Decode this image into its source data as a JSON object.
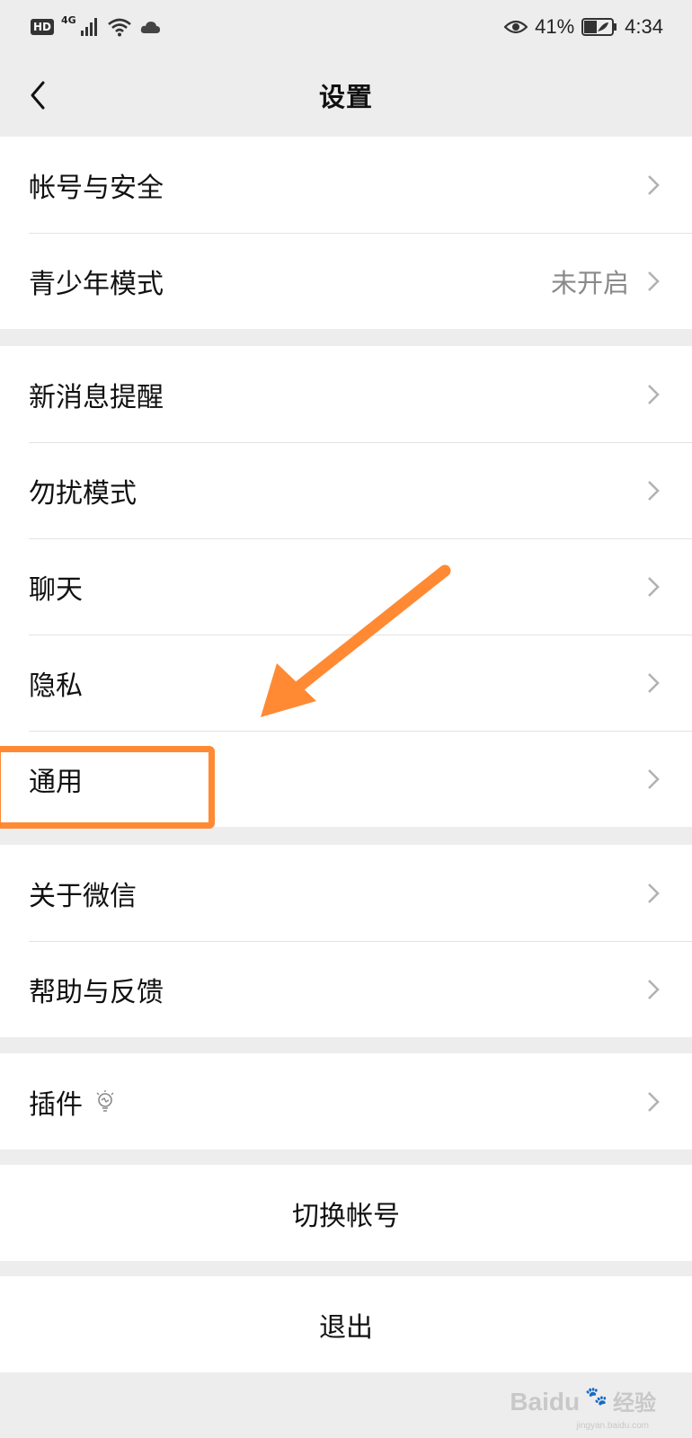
{
  "status_bar": {
    "hd": "HD",
    "network": "4G",
    "battery_percent": "41%",
    "time": "4:34"
  },
  "header": {
    "title": "设置"
  },
  "groups": [
    {
      "items": [
        {
          "label": "帐号与安全",
          "value": ""
        },
        {
          "label": "青少年模式",
          "value": "未开启"
        }
      ]
    },
    {
      "items": [
        {
          "label": "新消息提醒",
          "value": ""
        },
        {
          "label": "勿扰模式",
          "value": ""
        },
        {
          "label": "聊天",
          "value": ""
        },
        {
          "label": "隐私",
          "value": ""
        },
        {
          "label": "通用",
          "value": ""
        }
      ]
    },
    {
      "items": [
        {
          "label": "关于微信",
          "value": ""
        },
        {
          "label": "帮助与反馈",
          "value": ""
        }
      ]
    },
    {
      "items": [
        {
          "label": "插件",
          "value": "",
          "icon": "lightbulb-icon"
        }
      ]
    }
  ],
  "actions": {
    "switch_account": "切换帐号",
    "logout": "退出"
  },
  "watermark": {
    "brand": "Baidu",
    "cn": "经验",
    "sub": "jingyan.baidu.com"
  },
  "annotation_color": "#ff8a33"
}
